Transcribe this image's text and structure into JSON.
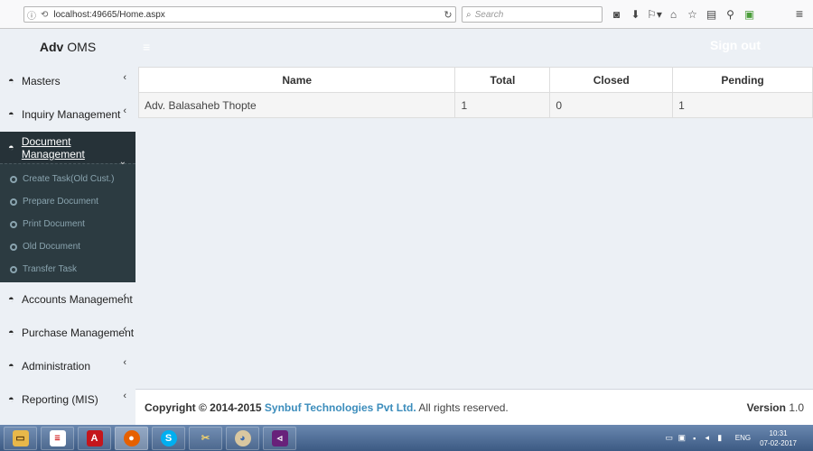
{
  "browser": {
    "url": "localhost:49665/Home.aspx",
    "search_placeholder": "Search",
    "toolbar_icons": [
      "pocket-icon",
      "download-icon",
      "addons-icon",
      "home-icon",
      "bookmark-star-icon",
      "reading-list-icon",
      "pin-icon",
      "extension-icon"
    ]
  },
  "app": {
    "logo_bold": "Adv",
    "logo_rest": "OMS",
    "signout_label": "Sign out"
  },
  "sidebar": {
    "items": [
      {
        "label": "Masters",
        "icon": "dashboard-icon"
      },
      {
        "label": "Inquiry Management",
        "icon": "dashboard-icon"
      },
      {
        "label": "Document Management",
        "icon": "dashboard-icon",
        "active": true
      },
      {
        "label": "Accounts Management",
        "icon": "dashboard-icon"
      },
      {
        "label": "Purchase Management",
        "icon": "dashboard-icon"
      },
      {
        "label": "Administration",
        "icon": "dashboard-icon"
      },
      {
        "label": "Reporting (MIS)",
        "icon": "dashboard-icon"
      }
    ],
    "submenu": [
      {
        "label": "Create Task(Old Cust.)"
      },
      {
        "label": "Prepare Document"
      },
      {
        "label": "Print Document"
      },
      {
        "label": "Old Document"
      },
      {
        "label": "Transfer Task"
      }
    ]
  },
  "table": {
    "headers": [
      "Name",
      "Total",
      "Closed",
      "Pending"
    ],
    "rows": [
      [
        "Adv. Balasaheb Thopte",
        "1",
        "0",
        "1"
      ]
    ]
  },
  "footer": {
    "copyright_bold": "Copyright © 2014-2015",
    "company": "Synbuf Technologies Pvt Ltd.",
    "rights": "All rights reserved.",
    "version_label": "Version",
    "version_value": "1.0"
  },
  "taskbar": {
    "apps": [
      "explorer-icon",
      "notepad-icon",
      "acrobat-icon",
      "firefox-icon",
      "skype-icon",
      "tools-icon",
      "paint-icon",
      "visual-studio-icon"
    ],
    "lang": "ENG",
    "time": "10:31",
    "date": "07-02-2017"
  }
}
